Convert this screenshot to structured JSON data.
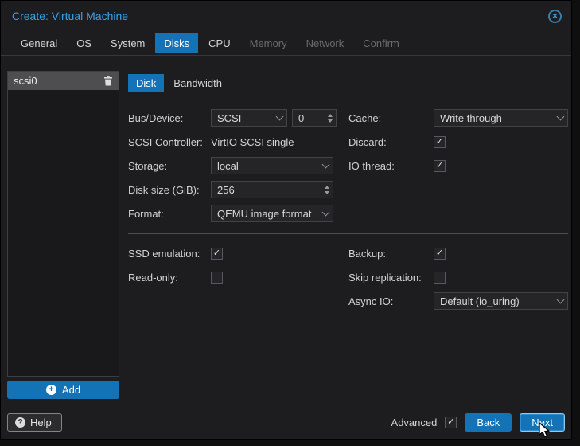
{
  "window": {
    "title": "Create: Virtual Machine"
  },
  "tabs": [
    {
      "label": "General",
      "state": "normal"
    },
    {
      "label": "OS",
      "state": "normal"
    },
    {
      "label": "System",
      "state": "normal"
    },
    {
      "label": "Disks",
      "state": "active"
    },
    {
      "label": "CPU",
      "state": "normal"
    },
    {
      "label": "Memory",
      "state": "disabled"
    },
    {
      "label": "Network",
      "state": "disabled"
    },
    {
      "label": "Confirm",
      "state": "disabled"
    }
  ],
  "disk_list": {
    "items": [
      {
        "label": "scsi0",
        "selected": true
      }
    ],
    "add_label": "Add"
  },
  "subtabs": [
    {
      "label": "Disk",
      "state": "active"
    },
    {
      "label": "Bandwidth",
      "state": "normal"
    }
  ],
  "form": {
    "bus_device": {
      "label": "Bus/Device:",
      "bus": "SCSI",
      "device": "0"
    },
    "scsi_controller": {
      "label": "SCSI Controller:",
      "value": "VirtIO SCSI single"
    },
    "storage": {
      "label": "Storage:",
      "value": "local"
    },
    "disk_size": {
      "label": "Disk size (GiB):",
      "value": "256"
    },
    "format": {
      "label": "Format:",
      "value": "QEMU image format"
    },
    "cache": {
      "label": "Cache:",
      "value": "Write through"
    },
    "discard": {
      "label": "Discard:",
      "checked": true
    },
    "io_thread": {
      "label": "IO thread:",
      "checked": true
    },
    "ssd_emulation": {
      "label": "SSD emulation:",
      "checked": true
    },
    "read_only": {
      "label": "Read-only:",
      "checked": false
    },
    "backup": {
      "label": "Backup:",
      "checked": true
    },
    "skip_replication": {
      "label": "Skip replication:",
      "checked": false
    },
    "async_io": {
      "label": "Async IO:",
      "value": "Default (io_uring)"
    }
  },
  "footer": {
    "help_label": "Help",
    "advanced_label": "Advanced",
    "advanced_checked": true,
    "back_label": "Back",
    "next_label": "Next"
  },
  "icons": {
    "check": "✓",
    "close": "✕",
    "plus": "+",
    "help": "?"
  },
  "colors": {
    "accent": "#1373b6",
    "title_text": "#3da0e0",
    "dialog_bg": "#1d1d1f"
  }
}
